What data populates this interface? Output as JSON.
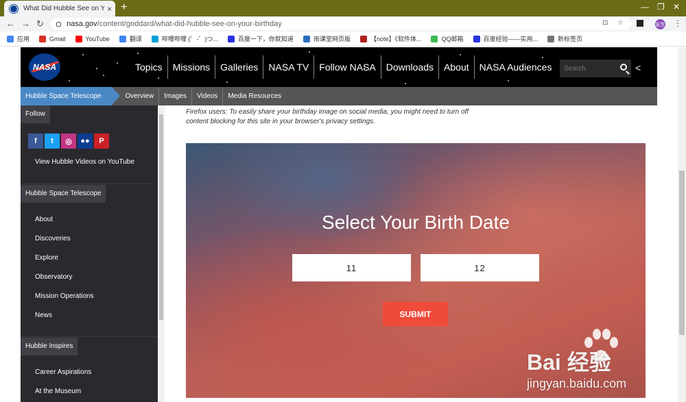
{
  "browser": {
    "tab_title": "What Did Hubble See on Your",
    "tab_close": "×",
    "new_tab": "+",
    "url_host": "nasa.gov",
    "url_path": "/content/goddard/what-did-hubble-see-on-your-birthday",
    "avatar_text": "友生",
    "bookmarks": [
      "应用",
      "Gmail",
      "YouTube",
      "翻译",
      "哔哩哔哩 (゜-゜)つ...",
      "百度一下，你就知道",
      "雨课堂网页版",
      "【note】《软件体...",
      "QQ邮箱",
      "百度经验——实用...",
      "新标签页"
    ],
    "bookmark_colors": [
      "#4285f4",
      "#d93025",
      "#ff0000",
      "#4285f4",
      "#00a1d6",
      "#2932e1",
      "#2a6ebb",
      "#b22222",
      "#3cba54",
      "#2932e1",
      "#777777"
    ]
  },
  "nasa": {
    "logo_text": "NASA",
    "nav": [
      "Topics",
      "Missions",
      "Galleries",
      "NASA TV",
      "Follow NASA",
      "Downloads",
      "About",
      "NASA Audiences"
    ],
    "search_placeholder": "Search"
  },
  "subnav": {
    "active": "Hubble Space Telescope",
    "items": [
      "Overview",
      "Images",
      "Videos",
      "Media Resources"
    ]
  },
  "sidebar": {
    "follow_heading": "Follow",
    "social": [
      {
        "icon": "facebook-icon",
        "glyph": "f",
        "color": "#3b5998"
      },
      {
        "icon": "twitter-icon",
        "glyph": "t",
        "color": "#1da1f2"
      },
      {
        "icon": "instagram-icon",
        "glyph": "◎",
        "color": "#c13584"
      },
      {
        "icon": "flickr-icon",
        "glyph": "●●",
        "color": "#0b3d91"
      },
      {
        "icon": "pinterest-icon",
        "glyph": "P",
        "color": "#cb2027"
      }
    ],
    "youtube_link": "View Hubble Videos on YouTube",
    "hubble_heading": "Hubble Space Telescope",
    "hubble_links": [
      "About",
      "Discoveries",
      "Explore",
      "Observatory",
      "Mission Operations",
      "News"
    ],
    "inspires_heading": "Hubble Inspires",
    "inspires_links": [
      "Career Aspirations",
      "At the Museum"
    ]
  },
  "main": {
    "firefox_note": "Firefox users: To easily share your birthday image on social media, you might need to turn off content blocking for this site in your browser's privacy settings.",
    "hero_title": "Select Your Birth Date",
    "month_value": "11",
    "day_value": "12",
    "submit_label": "SUBMIT"
  },
  "watermark": {
    "brand": "Bai  经验",
    "url": "jingyan.baidu.com"
  }
}
